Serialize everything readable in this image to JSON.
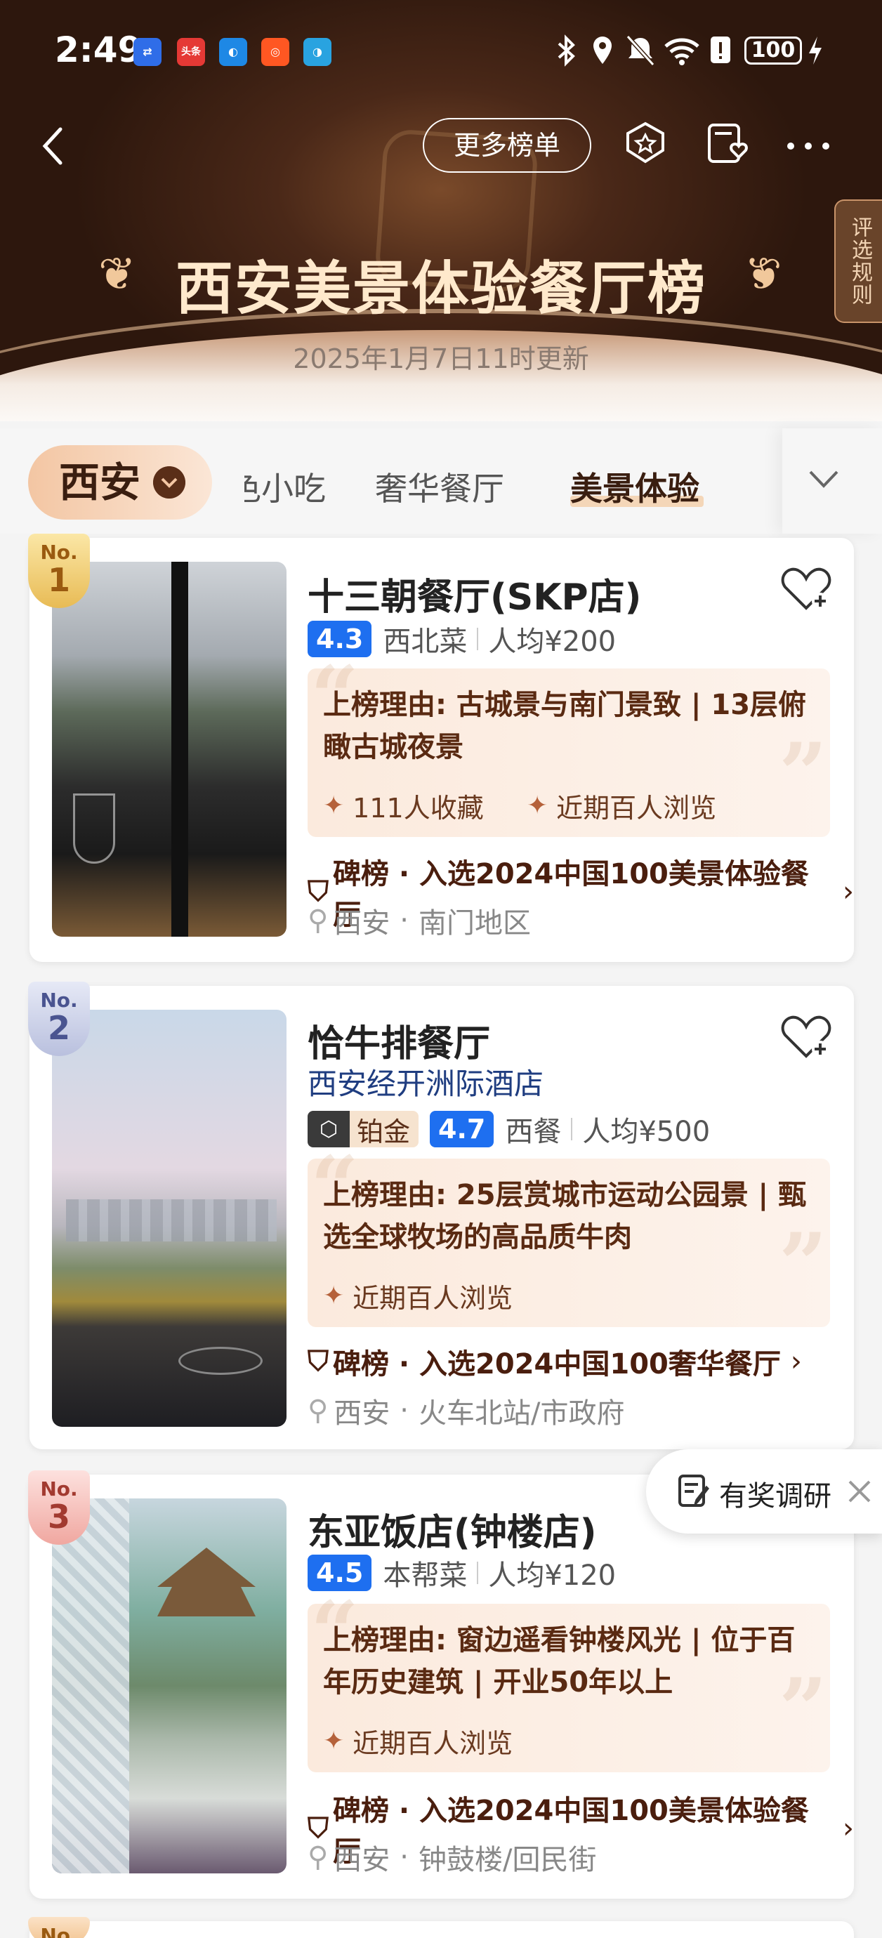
{
  "status_bar": {
    "time": "2:49",
    "battery": "100",
    "app_icons": [
      "usb-debug",
      "toutiao",
      "browser",
      "app-red",
      "app-blue"
    ],
    "toutiao_label": "头条"
  },
  "header": {
    "more_lists": "更多榜单",
    "rules": "评选规则",
    "title": "西安美景体验餐厅榜",
    "updated": "2025年1月7日11时更新"
  },
  "tabs": {
    "city": "西安",
    "items": [
      "色小吃",
      "奢华餐厅",
      "美景体验"
    ],
    "active": "美景体验"
  },
  "restaurants": [
    {
      "rank": "1",
      "no": "No.",
      "name": "十三朝餐厅(SKP店)",
      "score": "4.3",
      "cuisine": "西北菜",
      "avg": "人均¥200",
      "reason": "上榜理由: 古城景与南门景致 | 13层俯瞰古城夜景",
      "stats": [
        "111人收藏",
        "近期百人浏览"
      ],
      "list": "碑榜 · 入选2024中国100美景体验餐厅",
      "city": "西安",
      "area": "南门地区"
    },
    {
      "rank": "2",
      "no": "No.",
      "name": "恰牛排餐厅",
      "subtitle": "西安经开洲际酒店",
      "tier": "铂金",
      "score": "4.7",
      "cuisine": "西餐",
      "avg": "人均¥500",
      "reason": "上榜理由: 25层赏城市运动公园景 | 甄选全球牧场的高品质牛肉",
      "stats": [
        "近期百人浏览"
      ],
      "list": "碑榜 · 入选2024中国100奢华餐厅",
      "city": "西安",
      "area": "火车北站/市政府"
    },
    {
      "rank": "3",
      "no": "No.",
      "name": "东亚饭店(钟楼店)",
      "score": "4.5",
      "cuisine": "本帮菜",
      "avg": "人均¥120",
      "reason": "上榜理由: 窗边遥看钟楼风光 | 位于百年历史建筑 | 开业50年以上",
      "stats": [
        "近期百人浏览"
      ],
      "list": "碑榜 · 入选2024中国100美景体验餐厅",
      "city": "西安",
      "area": "钟鼓楼/回民街"
    }
  ],
  "next_card": {
    "no": "No."
  },
  "survey": {
    "label": "有奖调研"
  },
  "colors": {
    "score_blue": "#1e6ff0",
    "brand_brown": "#5a2e18",
    "gold": "#f1c89b"
  }
}
